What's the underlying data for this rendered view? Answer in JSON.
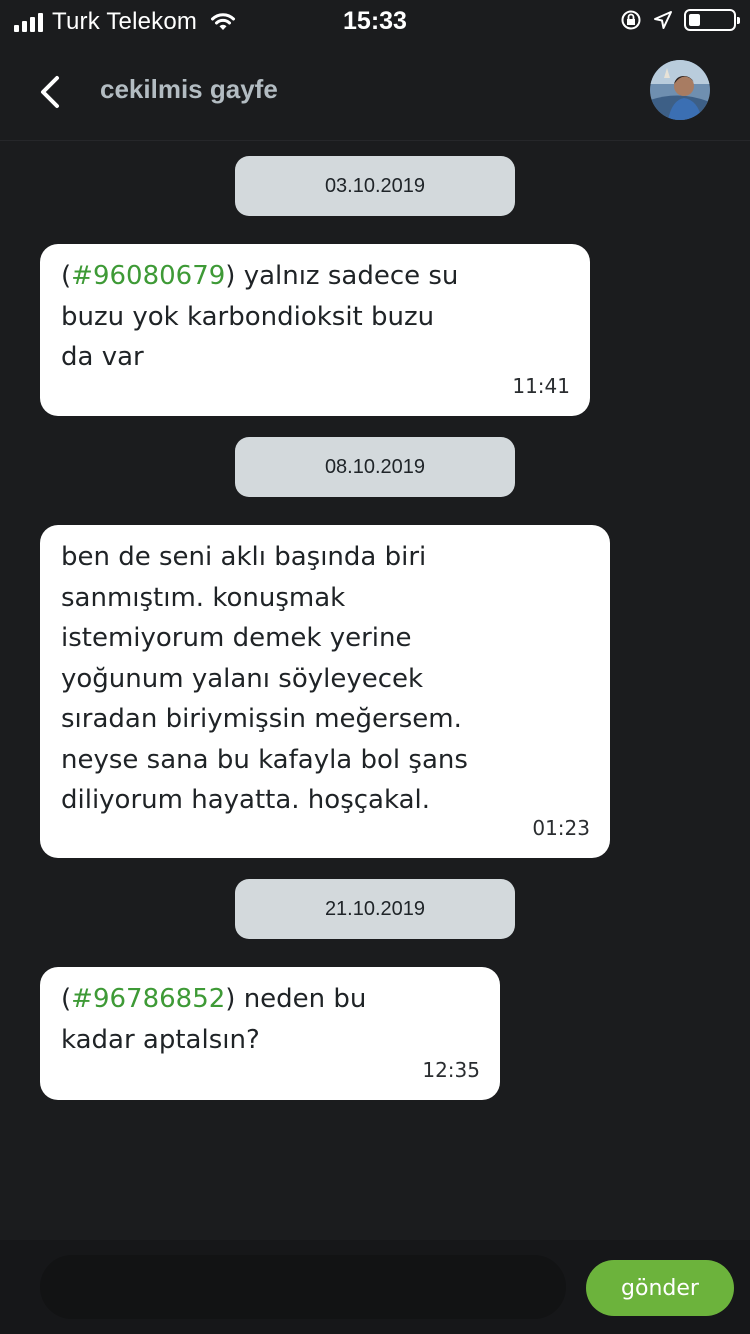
{
  "status_bar": {
    "carrier": "Turk Telekom",
    "time": "15:33"
  },
  "header": {
    "title": "cekilmis gayfe"
  },
  "messages": [
    {
      "date": "03.10.2019",
      "hash": "#96080679",
      "text_before": "(",
      "text_after": ") yalnız sadece su\nbuzu yok karbondioksit buzu\nda var",
      "time": "11:41"
    },
    {
      "date": "08.10.2019",
      "text": "ben de seni aklı başında biri\nsanmıştım. konuşmak\nistemiyorum demek yerine\nyoğunum yalanı söyleyecek\nsıradan biriymişsin meğersem.\nneyse sana bu kafayla bol şans\ndiliyorum hayatta. hoşçakal.",
      "time": "01:23"
    },
    {
      "date": "21.10.2019",
      "hash": "#96786852",
      "text_before": "(",
      "text_after": ") neden bu\nkadar aptalsın?",
      "time": "12:35"
    }
  ],
  "composer": {
    "placeholder": "",
    "send_label": "gönder"
  },
  "colors": {
    "background": "#1b1c1e",
    "bubble": "#ffffff",
    "date_pill": "#d3d9dc",
    "hashtag": "#3e9a36",
    "send_button": "#6cb33c"
  }
}
